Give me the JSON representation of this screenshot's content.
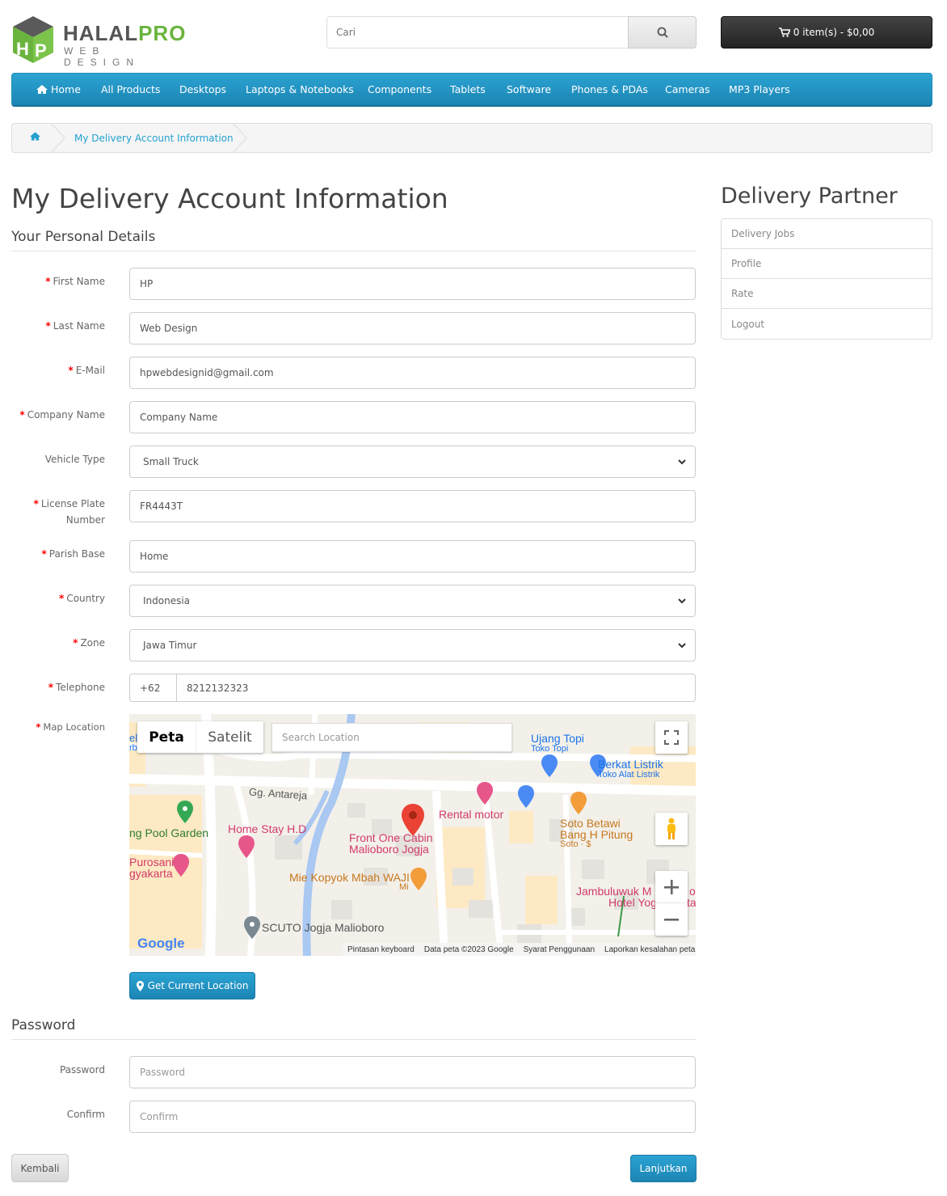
{
  "brand": {
    "name_main": "HALAL",
    "name_accent": "PRO",
    "tagline": "WEB DESIGN",
    "colors": {
      "accent": "#6ab43e",
      "primary": "#23a1d1"
    }
  },
  "search": {
    "placeholder": "Cari",
    "icon": "search-icon"
  },
  "cart": {
    "label": "0 item(s) - $0,00",
    "icon": "cart-icon"
  },
  "menu": [
    "Home",
    "All Products",
    "Desktops",
    "Laptops & Notebooks",
    "Components",
    "Tablets",
    "Software",
    "Phones & PDAs",
    "Cameras",
    "MP3 Players"
  ],
  "breadcrumb": {
    "home_icon": "home-icon",
    "current": "My Delivery Account Information"
  },
  "page": {
    "title": "My Delivery Account Information",
    "section_personal": "Your Personal Details",
    "section_password": "Password"
  },
  "fields": {
    "first_name": {
      "label": "First Name",
      "value": "HP"
    },
    "last_name": {
      "label": "Last Name",
      "value": "Web Design"
    },
    "email": {
      "label": "E-Mail",
      "value": "hpwebdesignid@gmail.com"
    },
    "company": {
      "label": "Company Name",
      "value": "Company Name"
    },
    "vehicle": {
      "label": "Vehicle Type",
      "value": "Small Truck"
    },
    "plate": {
      "label_line1": "License Plate",
      "label_line2": "Number",
      "value": "FR4443T"
    },
    "parish": {
      "label": "Parish Base",
      "value": "Home"
    },
    "country": {
      "label": "Country",
      "value": "Indonesia"
    },
    "zone": {
      "label": "Zone",
      "value": "Jawa Timur"
    },
    "telephone": {
      "label": "Telephone",
      "code": "+62",
      "value": "8212132323"
    },
    "map": {
      "label": "Map Location"
    },
    "password": {
      "label": "Password",
      "placeholder": "Password"
    },
    "confirm": {
      "label": "Confirm",
      "placeholder": "Confirm"
    }
  },
  "map": {
    "tab_map": "Peta",
    "tab_satellite": "Satelit",
    "search_placeholder": "Search Location",
    "google": "Google",
    "footer": [
      "Pintasan keyboard",
      "Data peta ©2023 Google",
      "Syarat Penggunaan",
      "Laporkan kesalahan peta"
    ],
    "pois": {
      "ujang": "Ujang Topi",
      "ujang_sub": "Toko Topi",
      "berkat": "Berkat Listrik",
      "berkat_sub": "Toko Alat Listrik",
      "antareja": "Gg. Antareja",
      "rental": "Rental motor",
      "soto1": "Soto Betawi",
      "soto2": "Bang H Pitung",
      "soto_sub": "Soto · $",
      "homestay": "Home Stay H.D",
      "frontone1": "Front One Cabin",
      "frontone2": "Malioboro Jogja",
      "pool": "ng Pool Garden",
      "purosani1": "Purosani",
      "purosani2": "gyakarta",
      "kopyok": "Mie Kopyok Mbah WAJI",
      "kopyok_sub": "Mi",
      "jambu1": "Jambuluwuk M",
      "jambu2": "Hotel Yog",
      "jambu_r1": "o",
      "jambu_r2": "ta",
      "scuto": "SCUTO Jogja Malioboro",
      "el": "el",
      "rb": "rb"
    }
  },
  "buttons": {
    "get_location": "Get Current Location",
    "back": "Kembali",
    "continue": "Lanjutkan"
  },
  "sidebar": {
    "title": "Delivery Partner",
    "items": [
      "Delivery Jobs",
      "Profile",
      "Rate",
      "Logout"
    ]
  }
}
